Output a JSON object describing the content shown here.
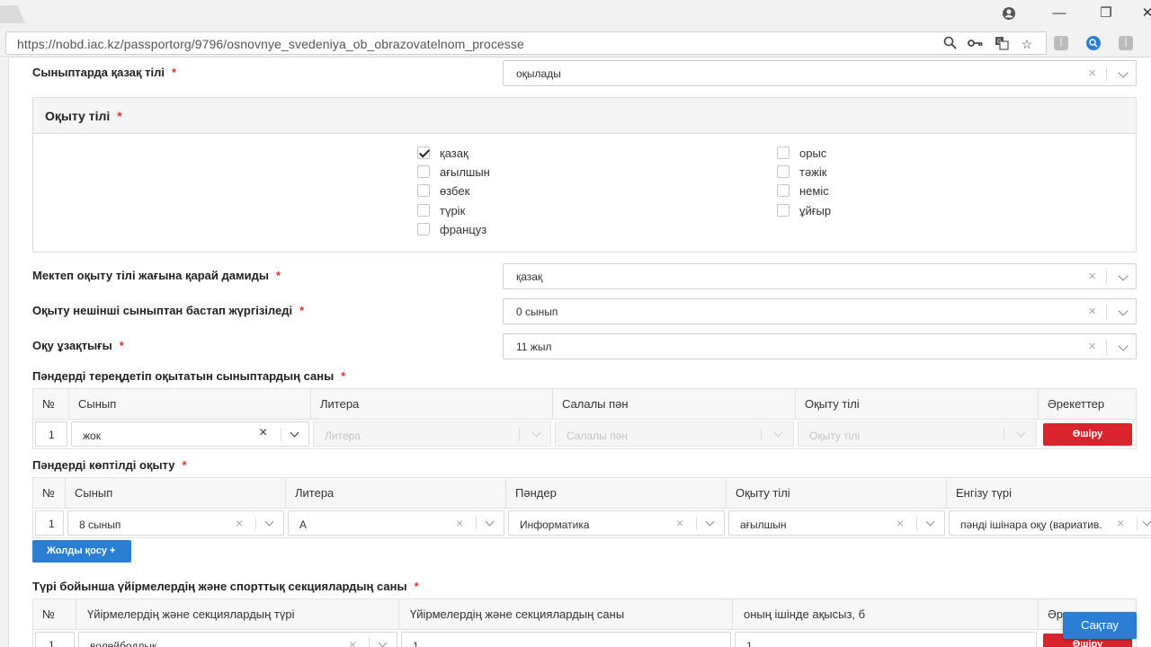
{
  "browser": {
    "url": "https://nobd.iac.kz/passportorg/9796/osnovnye_svedeniya_ob_obrazovatelnom_processe",
    "url_icons": [
      "zoom-icon",
      "key-icon",
      "translate-icon",
      "star-icon"
    ],
    "window_controls": {
      "minimize": "—",
      "restore": "❐",
      "close": "✕"
    }
  },
  "form": {
    "kazakh_in_classes": {
      "label": "Сыныптарда қазақ тілі",
      "value": "оқылады"
    },
    "teaching_language": {
      "title": "Оқыту тілі",
      "options_left": [
        {
          "label": "қазақ",
          "checked": true
        },
        {
          "label": "ағылшын",
          "checked": false
        },
        {
          "label": "өзбек",
          "checked": false
        },
        {
          "label": "түрік",
          "checked": false
        },
        {
          "label": "француз",
          "checked": false
        }
      ],
      "options_right": [
        {
          "label": "орыс",
          "checked": false
        },
        {
          "label": "тәжік",
          "checked": false
        },
        {
          "label": "неміс",
          "checked": false
        },
        {
          "label": "ұйғыр",
          "checked": false
        }
      ]
    },
    "school_develops": {
      "label": "Мектеп оқыту тілі жағына қарай дамиды",
      "value": "қазақ"
    },
    "start_class": {
      "label": "Оқыту нешінші сыныптан бастап жүргізіледі",
      "value": "0 сынып"
    },
    "duration": {
      "label": "Оқу ұзақтығы",
      "value": "11 жыл"
    },
    "deep_study": {
      "title": "Пәндерді тереңдетіп оқытатын сыныптардың саны",
      "columns": [
        "№",
        "Сынып",
        "Литера",
        "Салалы пән",
        "Оқыту тілі",
        "Әрекеттер"
      ],
      "row": {
        "num": "1",
        "class": "жок",
        "litera": "Литера",
        "subject": "Салалы пән",
        "language": "Оқыту тілі",
        "delete": "Өшіру"
      }
    },
    "multilingual": {
      "title": "Пәндерді көптілді оқыту",
      "columns": [
        "№",
        "Сынып",
        "Литера",
        "Пәндер",
        "Оқыту тілі",
        "Енгізу түрі"
      ],
      "row": {
        "num": "1",
        "class": "8 сынып",
        "litera": "А",
        "subject": "Информатика",
        "language": "ағылшын",
        "type": "пәнді ішінара оқу (вариатив."
      },
      "add_row": "Жолды қосу  +"
    },
    "clubs": {
      "title": "Түрі бойынша үйірмелердің және спорттық секциялардың саны",
      "columns": [
        "№",
        "Үйірмелердің және секциялардың түрі",
        "Үйірмелердің және секциялардың саны",
        "оның ішінде ақысыз, б",
        "Әр"
      ],
      "row": {
        "num": "1",
        "type": "волейбодлык",
        "count": "1",
        "free": "1",
        "delete": "Өшіру"
      }
    },
    "save": "Сақтау"
  }
}
